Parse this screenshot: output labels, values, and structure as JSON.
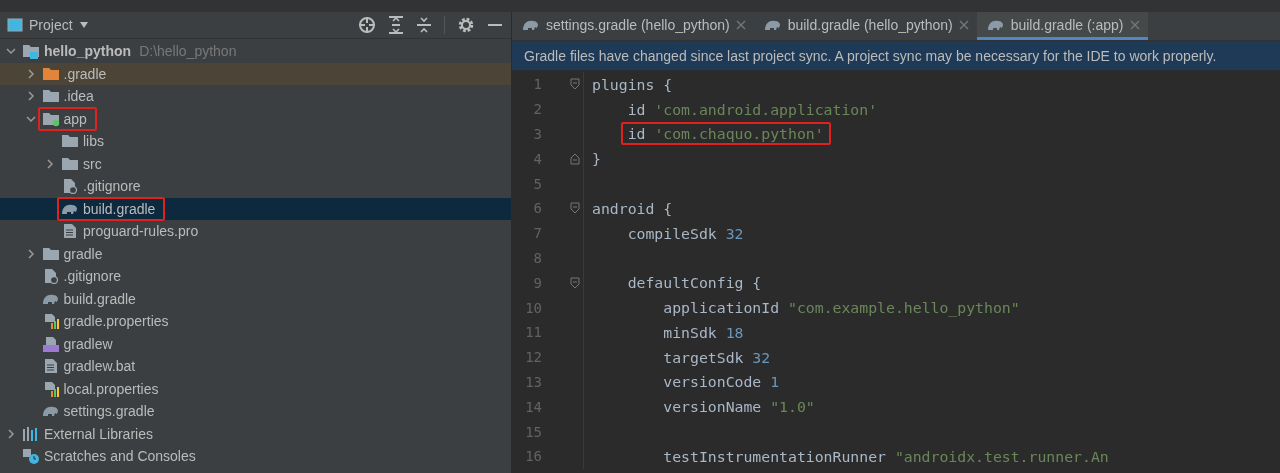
{
  "project_panel": {
    "title": "Project",
    "tree": [
      {
        "label": "hello_python",
        "path": "D:\\hello_python",
        "kind": "module",
        "expanded": true,
        "selected": false,
        "highlighted": false,
        "children": [
          {
            "label": ".gradle",
            "kind": "excluded",
            "expanded": false,
            "selected": false,
            "highlighted": false
          },
          {
            "label": ".idea",
            "kind": "folder",
            "expanded": false,
            "selected": false,
            "highlighted": false
          },
          {
            "label": "app",
            "kind": "submodule",
            "expanded": true,
            "selected": false,
            "highlighted": true,
            "children": [
              {
                "label": "libs",
                "kind": "folder",
                "selected": false,
                "highlighted": false
              },
              {
                "label": "src",
                "kind": "folder",
                "expanded": false,
                "selected": false,
                "highlighted": false
              },
              {
                "label": ".gitignore",
                "kind": "ignore",
                "selected": false,
                "highlighted": false
              },
              {
                "label": "build.gradle",
                "kind": "gradle",
                "selected": true,
                "highlighted": true
              },
              {
                "label": "proguard-rules.pro",
                "kind": "text",
                "selected": false,
                "highlighted": false
              }
            ]
          },
          {
            "label": "gradle",
            "kind": "folder",
            "expanded": false,
            "selected": false,
            "highlighted": false
          },
          {
            "label": ".gitignore",
            "kind": "ignore",
            "selected": false,
            "highlighted": false
          },
          {
            "label": "build.gradle",
            "kind": "gradle",
            "selected": false,
            "highlighted": false
          },
          {
            "label": "gradle.properties",
            "kind": "properties",
            "selected": false,
            "highlighted": false
          },
          {
            "label": "gradlew",
            "kind": "script",
            "selected": false,
            "highlighted": false
          },
          {
            "label": "gradlew.bat",
            "kind": "text",
            "selected": false,
            "highlighted": false
          },
          {
            "label": "local.properties",
            "kind": "properties",
            "selected": false,
            "highlighted": false
          },
          {
            "label": "settings.gradle",
            "kind": "gradle",
            "selected": false,
            "highlighted": false
          }
        ]
      },
      {
        "label": "External Libraries",
        "kind": "libraries",
        "expanded": false,
        "selected": false,
        "highlighted": false
      },
      {
        "label": "Scratches and Consoles",
        "kind": "scratches",
        "selected": false,
        "highlighted": false
      }
    ]
  },
  "editor": {
    "tabs": [
      {
        "label": "settings.gradle (hello_python)",
        "selected": false
      },
      {
        "label": "build.gradle (hello_python)",
        "selected": false
      },
      {
        "label": "build.gradle (:app)",
        "selected": true
      }
    ],
    "banner": "Gradle files have changed since last project sync. A project sync may be necessary for the IDE to work properly.",
    "lines": [
      {
        "number": "1",
        "kind": "start",
        "highlighted": false,
        "tokens": [
          {
            "kind": "plain",
            "text": "plugins {"
          }
        ]
      },
      {
        "number": "2",
        "kind": "plain",
        "highlighted": false,
        "tokens": [
          {
            "kind": "plain",
            "text": "    id "
          },
          {
            "kind": "string",
            "text": "'com.android.application'"
          }
        ]
      },
      {
        "number": "3",
        "kind": "plain",
        "highlighted": true,
        "tokens": [
          {
            "kind": "plain",
            "text": "    id "
          },
          {
            "kind": "string",
            "text": "'com.chaquo.python'"
          }
        ]
      },
      {
        "number": "4",
        "kind": "end",
        "highlighted": false,
        "tokens": [
          {
            "kind": "plain",
            "text": "}"
          }
        ]
      },
      {
        "number": "5",
        "kind": "plain",
        "highlighted": false
      },
      {
        "number": "6",
        "kind": "start",
        "highlighted": false,
        "tokens": [
          {
            "kind": "plain",
            "text": "android {"
          }
        ]
      },
      {
        "number": "7",
        "kind": "plain",
        "highlighted": false,
        "tokens": [
          {
            "kind": "plain",
            "text": "    compileSdk "
          },
          {
            "kind": "number",
            "text": "32"
          }
        ]
      },
      {
        "number": "8",
        "kind": "plain",
        "highlighted": false
      },
      {
        "number": "9",
        "kind": "start",
        "highlighted": false,
        "tokens": [
          {
            "kind": "plain",
            "text": "    defaultConfig {"
          }
        ]
      },
      {
        "number": "10",
        "kind": "plain",
        "highlighted": false,
        "tokens": [
          {
            "kind": "plain",
            "text": "        applicationId "
          },
          {
            "kind": "string",
            "text": "\"com.example.hello_python\""
          }
        ]
      },
      {
        "number": "11",
        "kind": "plain",
        "highlighted": false,
        "tokens": [
          {
            "kind": "plain",
            "text": "        minSdk "
          },
          {
            "kind": "number",
            "text": "18"
          }
        ]
      },
      {
        "number": "12",
        "kind": "plain",
        "highlighted": false,
        "tokens": [
          {
            "kind": "plain",
            "text": "        targetSdk "
          },
          {
            "kind": "number",
            "text": "32"
          }
        ]
      },
      {
        "number": "13",
        "kind": "plain",
        "highlighted": false,
        "tokens": [
          {
            "kind": "plain",
            "text": "        versionCode "
          },
          {
            "kind": "number",
            "text": "1"
          }
        ]
      },
      {
        "number": "14",
        "kind": "plain",
        "highlighted": false,
        "tokens": [
          {
            "kind": "plain",
            "text": "        versionName "
          },
          {
            "kind": "string",
            "text": "\"1.0\""
          }
        ]
      },
      {
        "number": "15",
        "kind": "plain",
        "highlighted": false
      },
      {
        "number": "16",
        "kind": "plain",
        "highlighted": false,
        "tokens": [
          {
            "kind": "plain",
            "text": "        testInstrumentationRunner "
          },
          {
            "kind": "string",
            "text": "\"androidx.test.runner.An"
          }
        ]
      }
    ]
  }
}
